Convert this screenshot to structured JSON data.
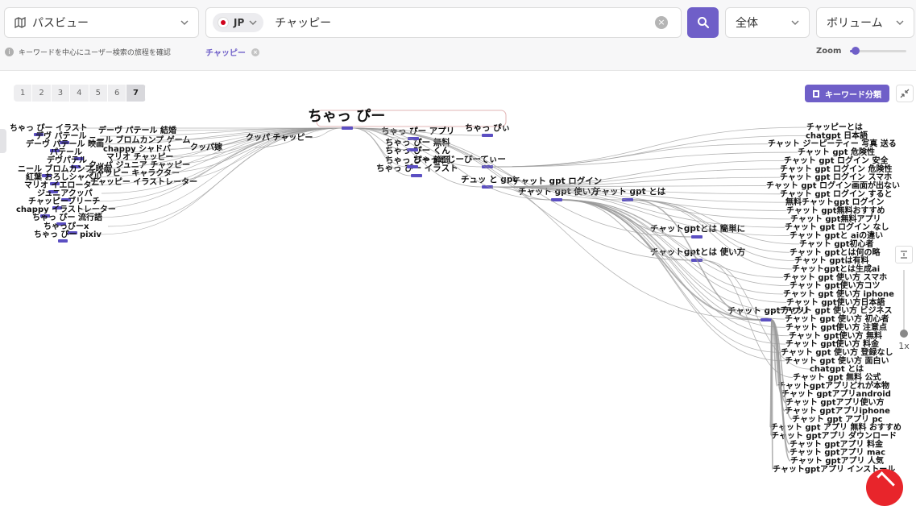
{
  "header": {
    "view_select": "パスビュー",
    "country_code": "JP",
    "search_value": "チャッピー",
    "clear_icon": "×",
    "scope_select": "全体",
    "volume_select": "ボリューム",
    "hint": "キーワードを中心にユーザー検索の旅程を確認",
    "chip_label": "チャッピー",
    "zoom_label": "Zoom",
    "zoom_level": 0.05
  },
  "toolbar": {
    "steps": [
      "1",
      "2",
      "3",
      "4",
      "5",
      "6",
      "7"
    ],
    "active_step": "7",
    "keyword_button": "キーワード分類",
    "vzoom_value": "1x"
  },
  "colors": {
    "accent": "#6f5fc8",
    "link": "#999999",
    "node": "#5b4fc2",
    "fab": "#e8252b"
  },
  "graph": {
    "root": "ちゃっ ぴー",
    "nodes_mid": [
      "ちゃっ ぴー アプリ",
      "ちゃっ ぴぃ",
      "ちゃっ ぴー 無料",
      "ちゃっ ぴー くん",
      "ちゃっ ぴー 静岡",
      "ちゃっとじーぴーてぃー",
      "ちゃっ ぴー イラスト",
      "チュッ と gpt",
      "チャット gpt ログイン",
      "チャット gpt 使い方",
      "チャット gpt とは",
      "チャットgptとは 簡単に",
      "チャットgptとは 使い方",
      "チャット gpt アプリ"
    ],
    "nodes_left": [
      "ちゃっ ぴー イラスト",
      "デヴ パテール",
      "デーヴ パテール 映画",
      "パテール",
      "デヴパテル",
      "ニール ブロムカンプ 映画",
      "紅葉 おろしシャベル",
      "マリオ イエローター",
      "ジュニアクッパ",
      "チャッピーブリーチ",
      "chappy イラストレーター",
      "ちゃっ ぴー 流行語",
      "ちゃっぴーx",
      "ちゃっ ぴー pixiv",
      "デーヴ パテール 結婚",
      "ニール ブロムカンプ ゲーム",
      "chappy シャドバ",
      "マリオ チャッピー",
      "クッパ ジュニア チャッピー",
      "チャッピー キャラクター",
      "チャッピー イラストレーター",
      "クッパ チャッピー",
      "クッパ嫁"
    ],
    "nodes_right": [
      "チャッピーとは",
      "chatgpt 日本語",
      "チャット ジーピーティー 写真 送る",
      "チャット gpt 危険性",
      "チャット gpt ログイン 安全",
      "チャット gpt ログイン 危険性",
      "チャット gpt ログイン スマホ",
      "チャット gpt ログイン画面が出ない",
      "チャット gpt ログイン すると",
      "無料チャットgpt ログイン",
      "チャット gpt無料おすすめ",
      "チャット gpt無料アプリ",
      "チャット gpt ログイン なし",
      "チャット gptと aiの違い",
      "チャット gpt初心者",
      "チャット gptとは何の略",
      "チャット gptは有料",
      "チャットgptとは生成ai",
      "チャット gpt 使い方 スマホ",
      "チャット gpt使い方コツ",
      "チャット gpt 使い方 iphone",
      "チャット gpt使い方日本語",
      "チャット gpt 使い方 ビジネス",
      "チャット gpt 使い方 初心者",
      "チャット gpt使い方 注意点",
      "チャット gpt使い方 無料",
      "チャット gpt使い方 料金",
      "チャット gpt 使い方 登録なし",
      "チャット gpt 使い方 面白い",
      "chatgpt とは",
      "チャット gpt 無料 公式",
      "チャットgptアプリどれが本物",
      "チャット gptアプリandroid",
      "チャット gptアプリ使い方",
      "チャット gptアプリiphone",
      "チャット gpt アプリ pc",
      "チャット gpt アプリ 無料 おすすめ",
      "チャット gptアプリ ダウンロード",
      "チャット gptアプリ 料金",
      "チャット gptアプリ mac",
      "チャット gptアプリ 人気",
      "チャットgptアプリ インストール"
    ]
  }
}
